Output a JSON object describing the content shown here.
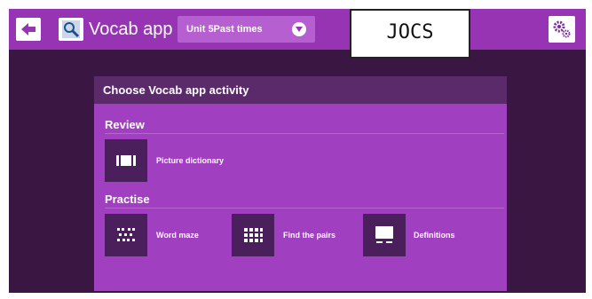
{
  "header": {
    "app_title": "Vocab app",
    "unit_label": "Unit 5Past times",
    "overlay_text": "JOCS"
  },
  "panel": {
    "title": "Choose Vocab app activity",
    "sections": [
      {
        "label": "Review",
        "activities": [
          {
            "label": "Picture dictionary",
            "icon": "picture-dictionary-icon"
          }
        ]
      },
      {
        "label": "Practise",
        "activities": [
          {
            "label": "Word maze",
            "icon": "word-maze-icon"
          },
          {
            "label": "Find the pairs",
            "icon": "find-the-pairs-icon"
          },
          {
            "label": "Definitions",
            "icon": "definitions-icon"
          }
        ]
      }
    ]
  },
  "colors": {
    "topbar": "#9634b4",
    "background": "#3a1742",
    "panel": "#a03fc0",
    "panel_header": "#5a2a6b",
    "icon_tile": "#4a1f5c"
  }
}
